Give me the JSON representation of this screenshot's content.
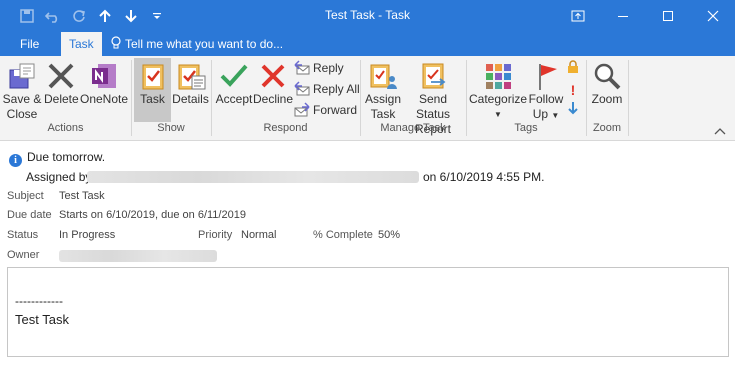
{
  "window": {
    "title": "Test Task - Task"
  },
  "qat": {
    "save_icon": "save-icon",
    "undo_icon": "undo-icon",
    "redo_icon": "redo-icon",
    "up_icon": "up-arrow-icon",
    "down_icon": "down-arrow-icon",
    "more_icon": "customize-icon"
  },
  "tabs": {
    "file": "File",
    "task": "Task",
    "tell_me": "Tell me what you want to do..."
  },
  "ribbon": {
    "actions": {
      "save_close": [
        "Save &",
        "Close"
      ],
      "delete": "Delete",
      "onenote": "OneNote",
      "group": "Actions"
    },
    "show": {
      "task": "Task",
      "details": "Details",
      "group": "Show"
    },
    "respond": {
      "accept": "Accept",
      "decline": "Decline",
      "reply": "Reply",
      "reply_all": "Reply All",
      "forward": "Forward",
      "group": "Respond"
    },
    "manage": {
      "assign": [
        "Assign",
        "Task"
      ],
      "send_status": [
        "Send Status",
        "Report"
      ],
      "group": "Manage Task"
    },
    "tags": {
      "categorize": "Categorize",
      "follow_up": [
        "Follow",
        "Up"
      ],
      "group": "Tags"
    },
    "zoom": {
      "zoom": "Zoom",
      "group": "Zoom"
    }
  },
  "info": {
    "due": "Due tomorrow.",
    "assigned_prefix": "Assigned by",
    "assigned_suffix": "on 6/10/2019 4:55 PM."
  },
  "fields": {
    "subject_label": "Subject",
    "subject": "Test Task",
    "due_label": "Due date",
    "due": "Starts on 6/10/2019, due on 6/11/2019",
    "status_label": "Status",
    "status": "In Progress",
    "priority_label": "Priority",
    "priority": "Normal",
    "complete_label": "% Complete",
    "complete": "50%",
    "owner_label": "Owner"
  },
  "body": {
    "separator": "------------",
    "text": "Test Task"
  },
  "colors": {
    "accent": "#2b78d7",
    "ribbon_bg": "#f3f3f3",
    "accept": "#3aa35c",
    "decline": "#e0352b",
    "onenote": "#7b2d8e"
  }
}
